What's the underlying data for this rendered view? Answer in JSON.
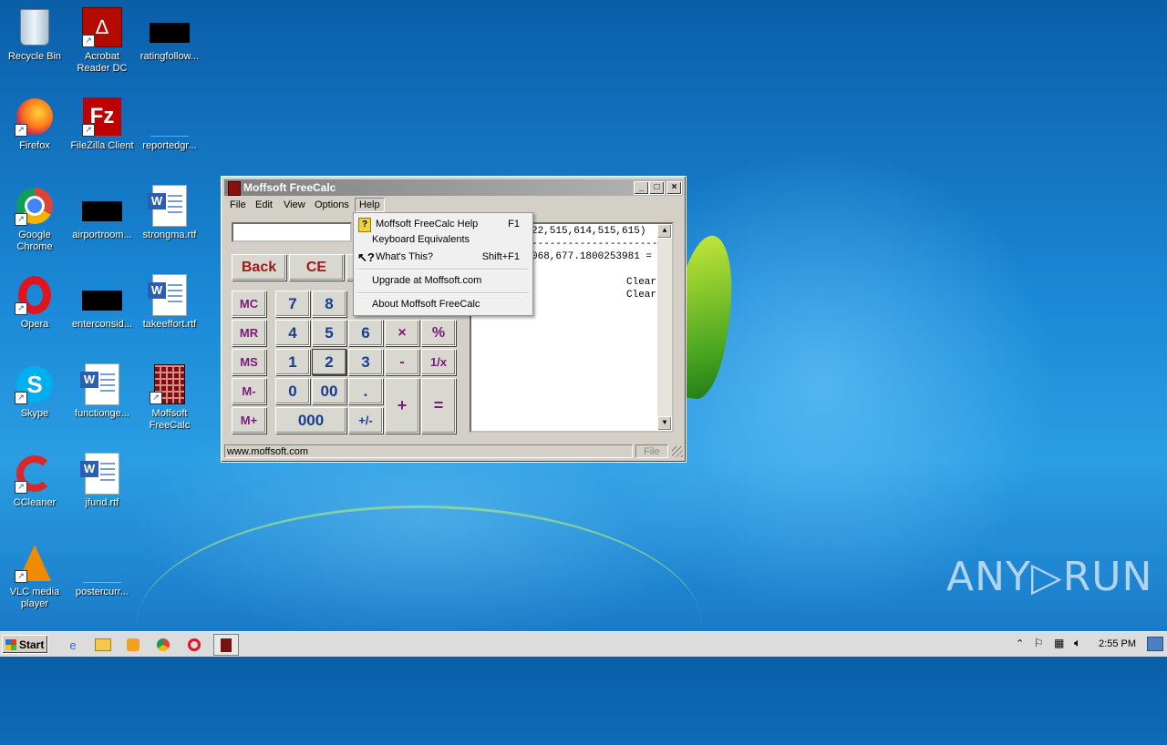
{
  "desktop": {
    "icons": [
      {
        "label": "Recycle Bin",
        "icon": "recycle-bin-icon"
      },
      {
        "label": "Acrobat Reader DC",
        "icon": "acrobat-icon"
      },
      {
        "label": "ratingfollow...",
        "icon": "redacted-file-icon"
      },
      {
        "label": "Firefox",
        "icon": "firefox-icon"
      },
      {
        "label": "FileZilla Client",
        "icon": "filezilla-icon"
      },
      {
        "label": "reportedgr...",
        "icon": "file-icon"
      },
      {
        "label": "Google Chrome",
        "icon": "chrome-icon"
      },
      {
        "label": "airportroom...",
        "icon": "redacted-file-icon"
      },
      {
        "label": "strongma.rtf",
        "icon": "word-doc-icon"
      },
      {
        "label": "Opera",
        "icon": "opera-icon"
      },
      {
        "label": "enterconsid...",
        "icon": "redacted-file-icon"
      },
      {
        "label": "takeeffort.rtf",
        "icon": "word-doc-icon"
      },
      {
        "label": "Skype",
        "icon": "skype-icon"
      },
      {
        "label": "functionge...",
        "icon": "word-doc-icon"
      },
      {
        "label": "Moffsoft FreeCalc",
        "icon": "calculator-icon"
      },
      {
        "label": "CCleaner",
        "icon": "ccleaner-icon"
      },
      {
        "label": "jfund.rtf",
        "icon": "word-doc-icon"
      },
      {
        "label": "VLC media player",
        "icon": "vlc-icon"
      },
      {
        "label": "postercurr...",
        "icon": "file-icon"
      }
    ]
  },
  "window": {
    "title": "Moffsoft FreeCalc",
    "menu": [
      "File",
      "Edit",
      "View",
      "Options",
      "Help"
    ],
    "top_buttons": {
      "back": "Back",
      "ce": "CE"
    },
    "memory": [
      "MC",
      "MR",
      "MS",
      "M-",
      "M+"
    ],
    "keys": {
      "k7": "7",
      "k8": "8",
      "k4": "4",
      "k5": "5",
      "k6": "6",
      "k1": "1",
      "k2": "2",
      "k3": "3",
      "k0": "0",
      "k00": "00",
      "k000": "000",
      "dot": ".",
      "plusminus": "+/-",
      "mul": "×",
      "pct": "%",
      "sub": "-",
      "recip": "1/x",
      "add": "+",
      "eq": "="
    },
    "tape_lines": [
      "22,515,614,515,615)",
      "-----------------------",
      "068,677.1800253981 =",
      "",
      "Clear",
      "Clear"
    ],
    "status": {
      "url": "www.moffsoft.com",
      "mode": "File"
    }
  },
  "help_menu": {
    "items": [
      {
        "label": "Moffsoft FreeCalc Help",
        "shortcut": "F1"
      },
      {
        "label": "Keyboard Equivalents",
        "shortcut": ""
      },
      {
        "label": "What's This?",
        "shortcut": "Shift+F1"
      },
      {
        "label": "Upgrade at Moffsoft.com",
        "shortcut": ""
      },
      {
        "label": "About Moffsoft FreeCalc",
        "shortcut": ""
      }
    ]
  },
  "taskbar": {
    "start_label": "Start",
    "clock": "2:55 PM"
  },
  "watermark": "ANY▷RUN"
}
